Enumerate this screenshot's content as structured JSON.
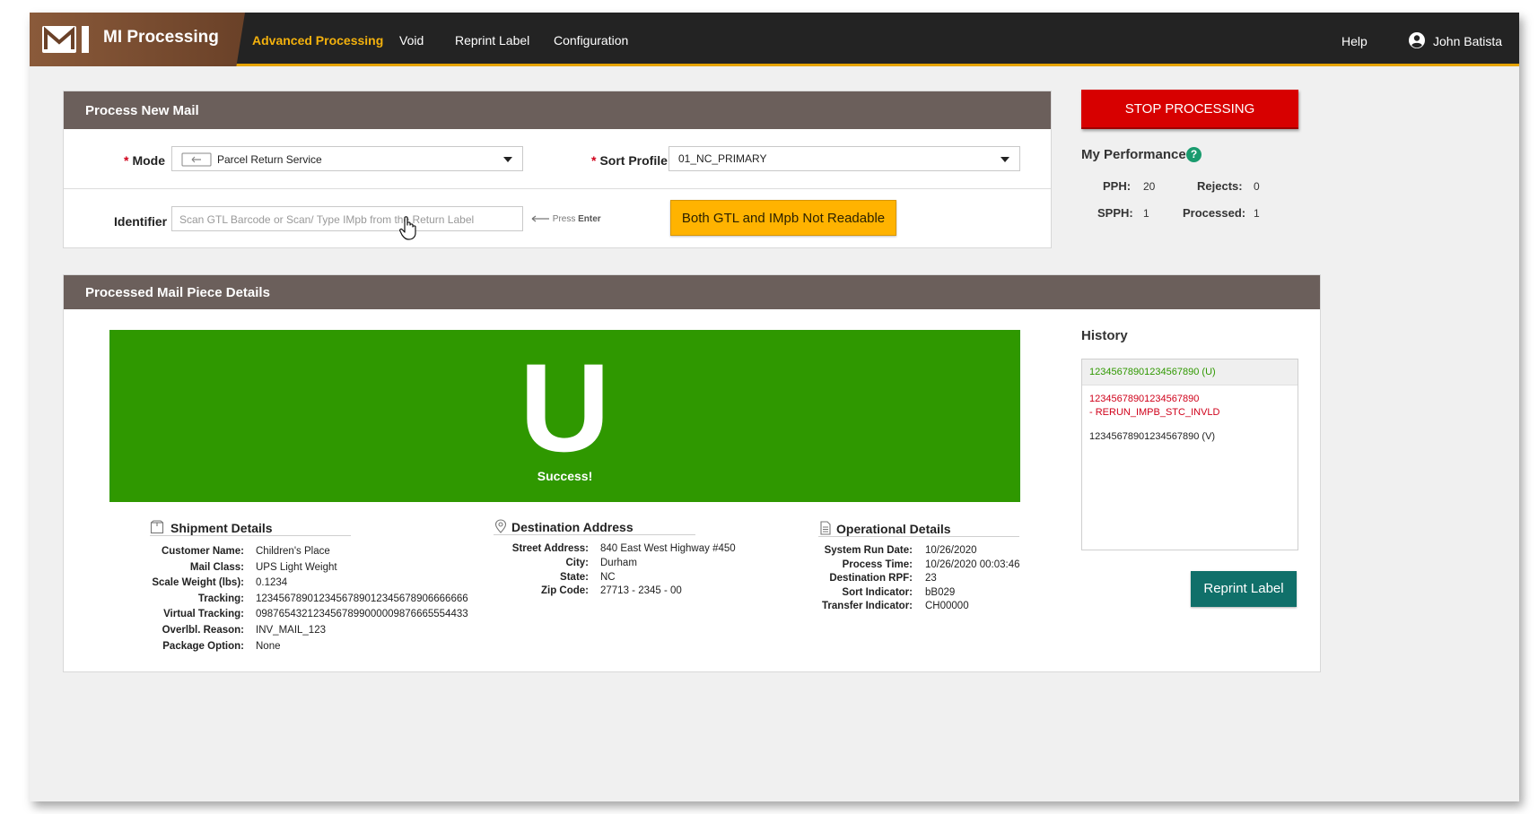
{
  "app": {
    "title": "MI Processing",
    "logo_text": "M"
  },
  "nav": {
    "items": [
      {
        "label": "Advanced Processing",
        "active": true
      },
      {
        "label": "Void",
        "active": false
      },
      {
        "label": "Reprint Label",
        "active": false
      },
      {
        "label": "Configuration",
        "active": false
      }
    ],
    "help": "Help",
    "user": "John Batista"
  },
  "process_panel": {
    "title": "Process New Mail",
    "mode_label": "Mode",
    "mode_value": "Parcel Return Service",
    "sort_profile_label": "Sort Profile",
    "sort_profile_value": "01_NC_PRIMARY",
    "identifier_label": "Identifier",
    "identifier_placeholder": "Scan GTL Barcode or Scan/ Type IMpb from the Return Label",
    "press_enter_prefix": "Press",
    "press_enter_key": "Enter",
    "not_readable_button": "Both GTL and IMpb Not Readable"
  },
  "stop_button": "STOP PROCESSING",
  "performance": {
    "title": "My Performance",
    "help_glyph": "?",
    "pph_label": "PPH:",
    "pph_value": "20",
    "rejects_label": "Rejects:",
    "rejects_value": "0",
    "spph_label": "SPPH:",
    "spph_value": "1",
    "processed_label": "Processed:",
    "processed_value": "1"
  },
  "details_panel": {
    "title": "Processed Mail Piece Details",
    "status_letter": "U",
    "status_text": "Success!",
    "status_color": "#2f9800"
  },
  "shipment": {
    "title": "Shipment Details",
    "rows": [
      {
        "label": "Customer Name:",
        "value": "Children's Place"
      },
      {
        "label": "Mail Class:",
        "value": "UPS Light Weight"
      },
      {
        "label": "Scale Weight (lbs):",
        "value": "0.1234"
      },
      {
        "label": "Tracking:",
        "value": "1234567890123456789012345678906666666"
      },
      {
        "label": "Virtual Tracking:",
        "value": "0987654321234567899000009876665554433"
      },
      {
        "label": "Overlbl. Reason:",
        "value": "INV_MAIL_123"
      },
      {
        "label": "Package Option:",
        "value": "None"
      }
    ]
  },
  "destination": {
    "title": "Destination Address",
    "rows": [
      {
        "label": "Street Address:",
        "value": "840 East West Highway #450"
      },
      {
        "label": "City:",
        "value": "Durham"
      },
      {
        "label": "State:",
        "value": "NC"
      },
      {
        "label": "Zip Code:",
        "value": "27713 - 2345 - 00"
      }
    ]
  },
  "operational": {
    "title": "Operational Details",
    "rows": [
      {
        "label": "System Run Date:",
        "value": "10/26/2020"
      },
      {
        "label": "Process Time:",
        "value": "10/26/2020 00:03:46"
      },
      {
        "label": "Destination RPF:",
        "value": "23"
      },
      {
        "label": "Sort Indicator:",
        "value": "bB029"
      },
      {
        "label": "Transfer Indicator:",
        "value": "CH00000"
      }
    ]
  },
  "history": {
    "title": "History",
    "items": [
      {
        "line1": "12345678901234567890 (U)",
        "line2": "",
        "color": "#2f9800"
      },
      {
        "line1": "12345678901234567890",
        "line2": "- RERUN_IMPB_STC_INVLD",
        "color": "#d0021b"
      },
      {
        "line1": "12345678901234567890 (V)",
        "line2": "",
        "color": "#222222"
      }
    ]
  },
  "reprint_button": "Reprint Label"
}
